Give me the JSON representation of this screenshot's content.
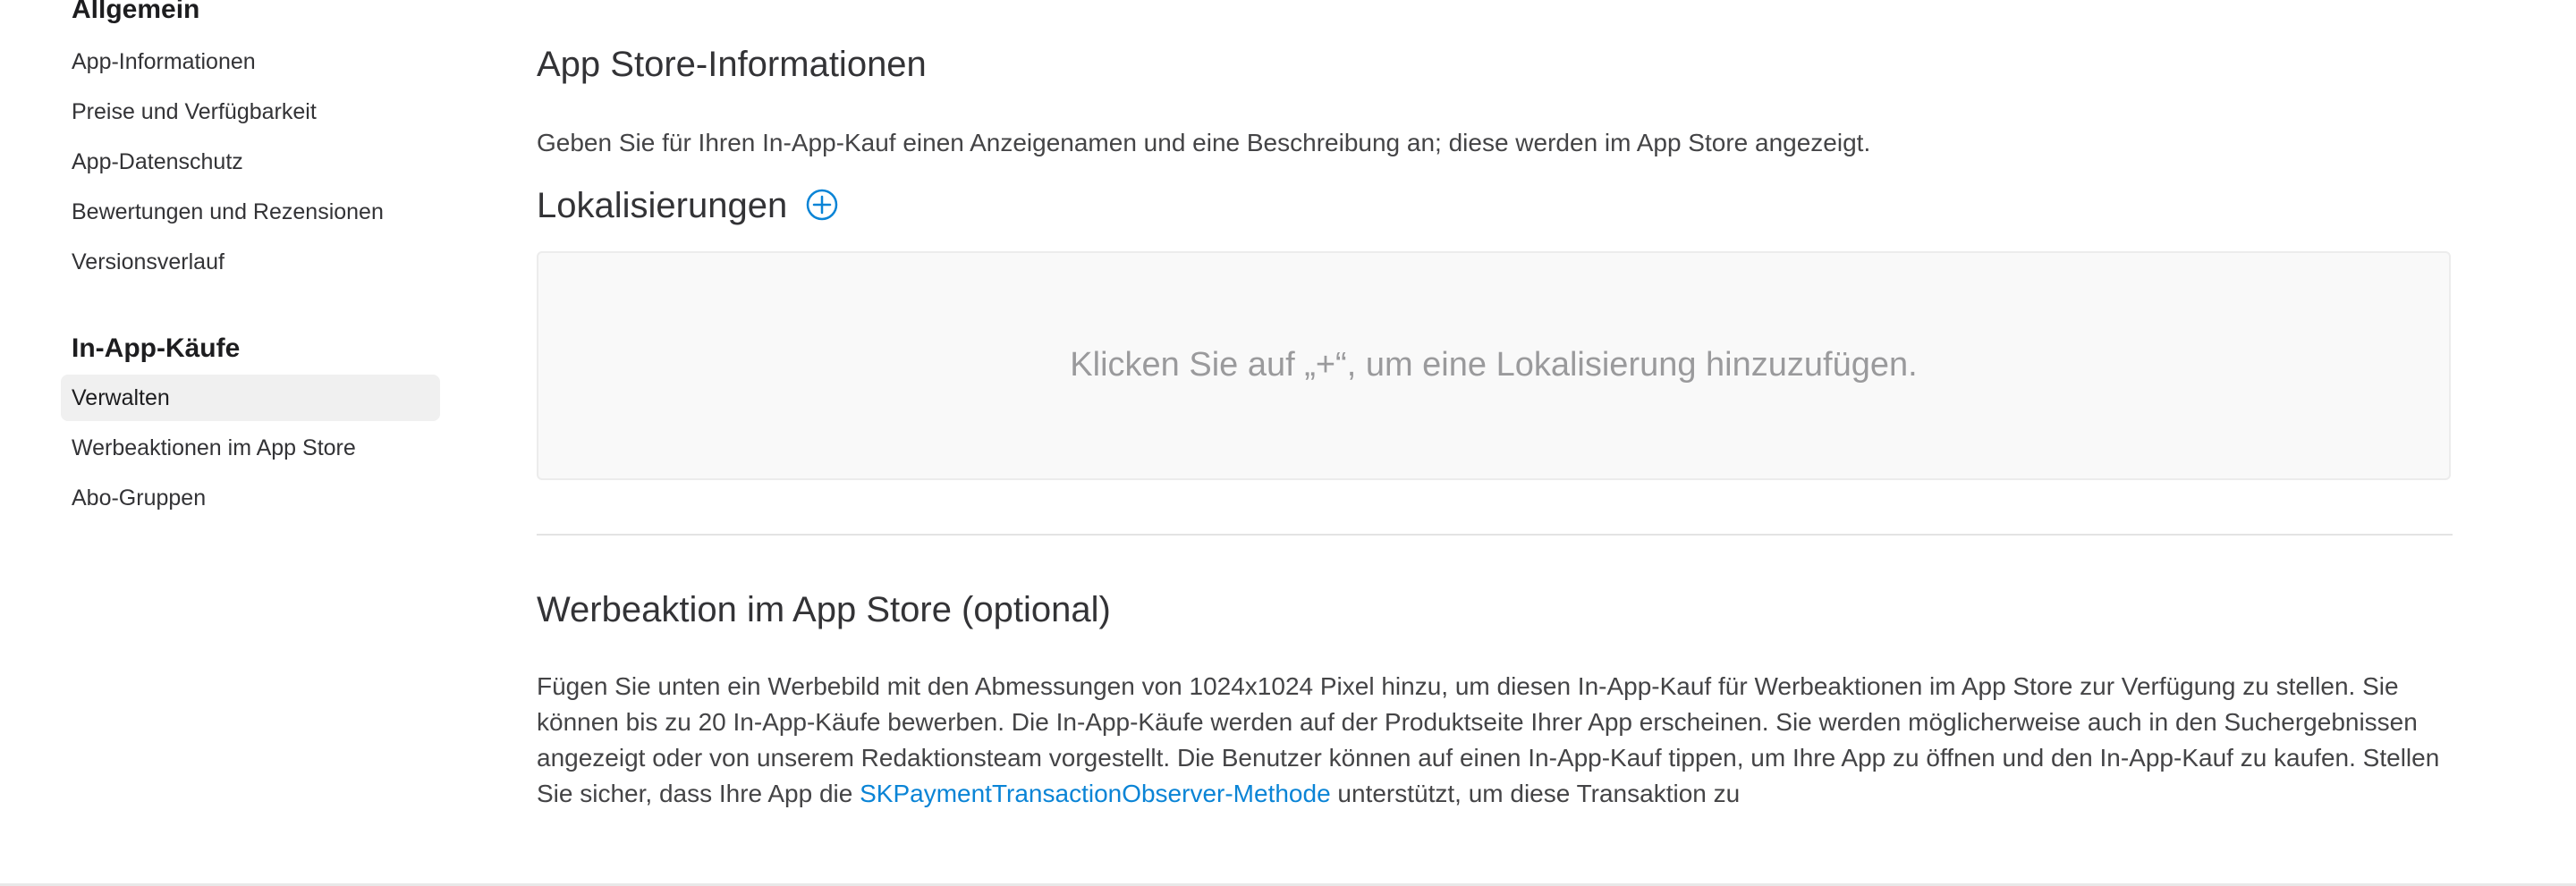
{
  "sidebar": {
    "group1_title": "Allgemein",
    "group1_items": [
      {
        "label": "App-Informationen"
      },
      {
        "label": "Preise und Verfügbarkeit"
      },
      {
        "label": "App-Datenschutz"
      },
      {
        "label": "Bewertungen und Rezensionen"
      },
      {
        "label": "Versionsverlauf"
      }
    ],
    "group2_title": "In-App-Käufe",
    "group2_items": [
      {
        "label": "Verwalten",
        "active": true
      },
      {
        "label": "Werbeaktionen im App Store"
      },
      {
        "label": "Abo-Gruppen"
      }
    ]
  },
  "main": {
    "store_info_title": "App Store-Informationen",
    "store_info_desc": "Geben Sie für Ihren In-App-Kauf einen Anzeigenamen und eine Beschreibung an; diese werden im App Store angezeigt.",
    "localizations_title": "Lokalisierungen",
    "add_icon": "plus-circle-icon",
    "localizations_empty": "Klicken Sie auf „+“, um eine Lokalisierung hinzuzufügen.",
    "promo_title": "Werbeaktion im App Store (optional)",
    "promo_desc_part1": "Fügen Sie unten ein Werbebild mit den Abmessungen von 1024x1024 Pixel hinzu, um diesen In-App-Kauf für Werbeaktionen im App Store zur Verfügung zu stellen. Sie können bis zu 20 In-App-Käufe bewerben. Die In-App-Käufe werden auf der Produktseite Ihrer App erscheinen. Sie werden möglicherweise auch in den Suchergebnissen angezeigt oder von unserem Redaktionsteam vorgestellt. Die Benutzer können auf einen In-App-Kauf tippen, um Ihre App zu öffnen und den In-App-Kauf zu kaufen. Stellen Sie sicher, dass Ihre App die ",
    "promo_link": "SKPaymentTransactionObserver-Methode",
    "promo_desc_part2": " unterstützt, um diese Transaktion zu "
  },
  "colors": {
    "accent": "#0a84d6",
    "active_bg": "#f0f0f0",
    "box_bg": "#f9f9f9"
  }
}
